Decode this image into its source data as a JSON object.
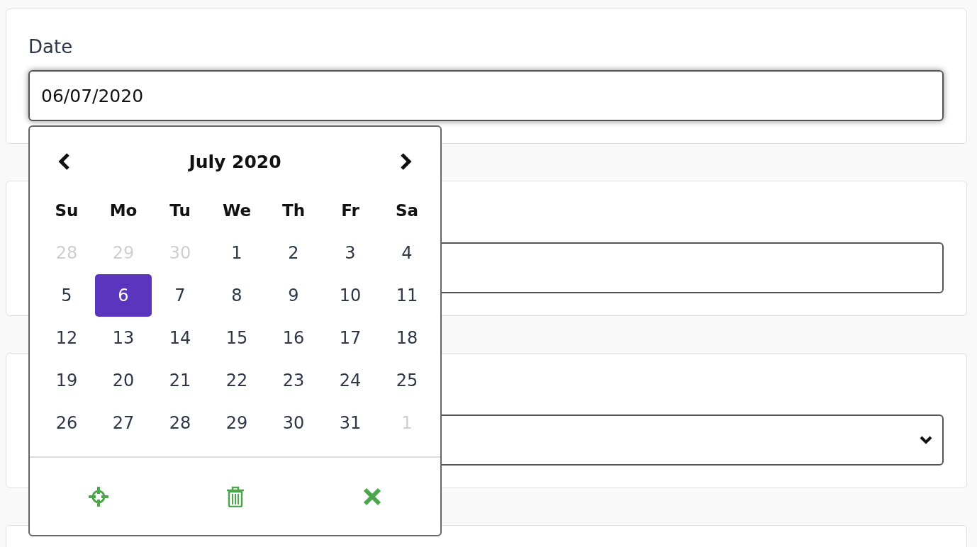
{
  "date_field": {
    "label": "Date",
    "value": "06/07/2020",
    "focused": true
  },
  "cards": [
    {
      "kind": "text"
    },
    {
      "kind": "select"
    },
    {
      "kind": "empty"
    }
  ],
  "calendar": {
    "title": "July 2020",
    "weekdays": [
      "Su",
      "Mo",
      "Tu",
      "We",
      "Th",
      "Fr",
      "Sa"
    ],
    "weeks": [
      [
        {
          "day": "28",
          "muted": true,
          "selected": false
        },
        {
          "day": "29",
          "muted": true,
          "selected": false
        },
        {
          "day": "30",
          "muted": true,
          "selected": false
        },
        {
          "day": "1",
          "muted": false,
          "selected": false
        },
        {
          "day": "2",
          "muted": false,
          "selected": false
        },
        {
          "day": "3",
          "muted": false,
          "selected": false
        },
        {
          "day": "4",
          "muted": false,
          "selected": false
        }
      ],
      [
        {
          "day": "5",
          "muted": false,
          "selected": false
        },
        {
          "day": "6",
          "muted": false,
          "selected": true
        },
        {
          "day": "7",
          "muted": false,
          "selected": false
        },
        {
          "day": "8",
          "muted": false,
          "selected": false
        },
        {
          "day": "9",
          "muted": false,
          "selected": false
        },
        {
          "day": "10",
          "muted": false,
          "selected": false
        },
        {
          "day": "11",
          "muted": false,
          "selected": false
        }
      ],
      [
        {
          "day": "12",
          "muted": false,
          "selected": false
        },
        {
          "day": "13",
          "muted": false,
          "selected": false
        },
        {
          "day": "14",
          "muted": false,
          "selected": false
        },
        {
          "day": "15",
          "muted": false,
          "selected": false
        },
        {
          "day": "16",
          "muted": false,
          "selected": false
        },
        {
          "day": "17",
          "muted": false,
          "selected": false
        },
        {
          "day": "18",
          "muted": false,
          "selected": false
        }
      ],
      [
        {
          "day": "19",
          "muted": false,
          "selected": false
        },
        {
          "day": "20",
          "muted": false,
          "selected": false
        },
        {
          "day": "21",
          "muted": false,
          "selected": false
        },
        {
          "day": "22",
          "muted": false,
          "selected": false
        },
        {
          "day": "23",
          "muted": false,
          "selected": false
        },
        {
          "day": "24",
          "muted": false,
          "selected": false
        },
        {
          "day": "25",
          "muted": false,
          "selected": false
        }
      ],
      [
        {
          "day": "26",
          "muted": false,
          "selected": false
        },
        {
          "day": "27",
          "muted": false,
          "selected": false
        },
        {
          "day": "28",
          "muted": false,
          "selected": false
        },
        {
          "day": "29",
          "muted": false,
          "selected": false
        },
        {
          "day": "30",
          "muted": false,
          "selected": false
        },
        {
          "day": "31",
          "muted": false,
          "selected": false
        },
        {
          "day": "1",
          "muted": true,
          "selected": false
        }
      ]
    ],
    "tools": [
      {
        "kind": "today"
      },
      {
        "kind": "clear"
      },
      {
        "kind": "close"
      }
    ]
  }
}
